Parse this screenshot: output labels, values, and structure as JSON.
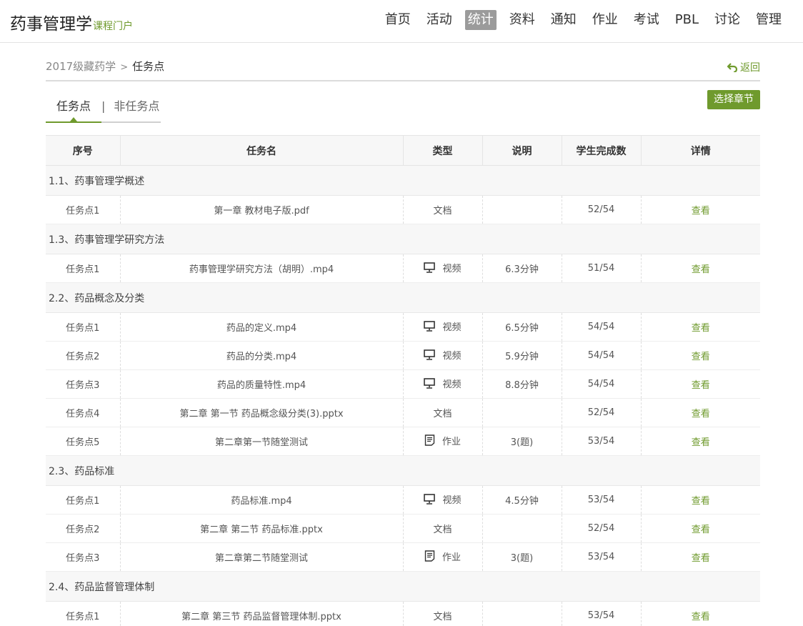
{
  "header": {
    "title": "药事管理学",
    "subtitle": "课程门户",
    "nav": [
      {
        "label": "首页",
        "active": false
      },
      {
        "label": "活动",
        "active": false
      },
      {
        "label": "统计",
        "active": true
      },
      {
        "label": "资料",
        "active": false
      },
      {
        "label": "通知",
        "active": false
      },
      {
        "label": "作业",
        "active": false
      },
      {
        "label": "考试",
        "active": false
      },
      {
        "label": "PBL",
        "active": false
      },
      {
        "label": "讨论",
        "active": false
      },
      {
        "label": "管理",
        "active": false
      }
    ]
  },
  "breadcrumb": {
    "parent": "2017级藏药学",
    "separator": ">",
    "current": "任务点",
    "back_label": "返回"
  },
  "tabs": {
    "active": "任务点",
    "divider": "|",
    "other": "非任务点"
  },
  "chapter_button": "选择章节",
  "table": {
    "columns": [
      "序号",
      "任务名",
      "类型",
      "说明",
      "学生完成数",
      "详情"
    ],
    "sections": [
      {
        "title": "1.1、药事管理学概述",
        "rows": [
          {
            "index": "任务点1",
            "name": "第一章 教材电子版.pdf",
            "type": "文档",
            "icon": "",
            "note": "",
            "done": "52/54",
            "detail": "查看"
          }
        ]
      },
      {
        "title": "1.3、药事管理学研究方法",
        "rows": [
          {
            "index": "任务点1",
            "name": "药事管理学研究方法（胡明）.mp4",
            "type": "视频",
            "icon": "monitor-icon",
            "note": "6.3分钟",
            "done": "51/54",
            "detail": "查看"
          }
        ]
      },
      {
        "title": "2.2、药品概念及分类",
        "rows": [
          {
            "index": "任务点1",
            "name": "药品的定义.mp4",
            "type": "视频",
            "icon": "monitor-icon",
            "note": "6.5分钟",
            "done": "54/54",
            "detail": "查看"
          },
          {
            "index": "任务点2",
            "name": "药品的分类.mp4",
            "type": "视频",
            "icon": "monitor-icon",
            "note": "5.9分钟",
            "done": "54/54",
            "detail": "查看"
          },
          {
            "index": "任务点3",
            "name": "药品的质量特性.mp4",
            "type": "视频",
            "icon": "monitor-icon",
            "note": "8.8分钟",
            "done": "54/54",
            "detail": "查看"
          },
          {
            "index": "任务点4",
            "name": "第二章 第一节 药品概念级分类(3).pptx",
            "type": "文档",
            "icon": "",
            "note": "",
            "done": "52/54",
            "detail": "查看"
          },
          {
            "index": "任务点5",
            "name": "第二章第一节随堂测试",
            "type": "作业",
            "icon": "assignment-icon",
            "note": "3(题)",
            "done": "53/54",
            "detail": "查看"
          }
        ]
      },
      {
        "title": "2.3、药品标准",
        "rows": [
          {
            "index": "任务点1",
            "name": "药品标准.mp4",
            "type": "视频",
            "icon": "monitor-icon",
            "note": "4.5分钟",
            "done": "53/54",
            "detail": "查看"
          },
          {
            "index": "任务点2",
            "name": "第二章 第二节 药品标准.pptx",
            "type": "文档",
            "icon": "",
            "note": "",
            "done": "52/54",
            "detail": "查看"
          },
          {
            "index": "任务点3",
            "name": "第二章第二节随堂测试",
            "type": "作业",
            "icon": "assignment-icon",
            "note": "3(题)",
            "done": "53/54",
            "detail": "查看"
          }
        ]
      },
      {
        "title": "2.4、药品监督管理体制",
        "rows": [
          {
            "index": "任务点1",
            "name": "第二章 第三节 药品监督管理体制.pptx",
            "type": "文档",
            "icon": "",
            "note": "",
            "done": "53/54",
            "detail": "查看"
          }
        ]
      }
    ]
  },
  "colors": {
    "accent": "#6f9a2d",
    "nav_active_bg": "#9b9b9b"
  }
}
